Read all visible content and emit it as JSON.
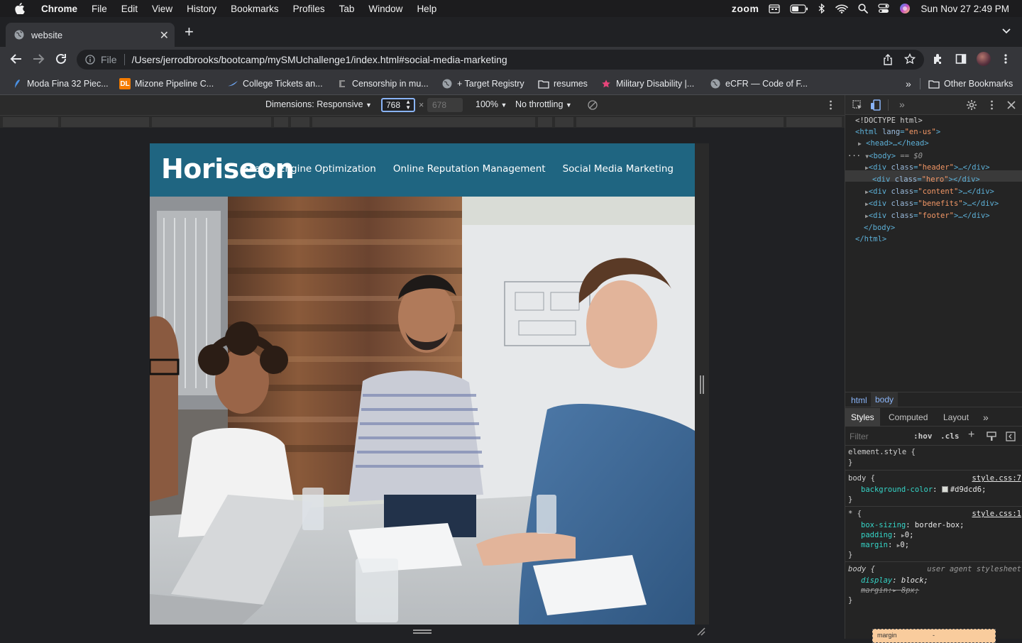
{
  "menubar": {
    "app": "Chrome",
    "items": [
      "File",
      "Edit",
      "View",
      "History",
      "Bookmarks",
      "Profiles",
      "Tab",
      "Window",
      "Help"
    ],
    "zoom": "zoom",
    "datetime": "Sun Nov 27  2:49 PM"
  },
  "tab": {
    "title": "website"
  },
  "toolbar": {
    "file_label": "File",
    "url": "/Users/jerrodbrooks/bootcamp/mySMUchallenge1/index.html#social-media-marketing"
  },
  "bookmarks": {
    "items": [
      {
        "label": "Moda Fina 32 Piec...",
        "icon": "bird-icon"
      },
      {
        "label": "Mizone Pipeline C...",
        "icon": "dl-icon",
        "badge": "DL"
      },
      {
        "label": "College Tickets an...",
        "icon": "swoosh-icon"
      },
      {
        "label": "Censorship in mu...",
        "icon": "site-icon"
      },
      {
        "label": "+ Target Registry",
        "icon": "globe-icon"
      },
      {
        "label": "resumes",
        "icon": "folder-icon"
      },
      {
        "label": "Military Disability |...",
        "icon": "star-icon"
      },
      {
        "label": "eCFR — Code of F...",
        "icon": "globe-icon"
      }
    ],
    "overflow": "»",
    "other": "Other Bookmarks"
  },
  "devbar": {
    "dimensions": "Dimensions: Responsive",
    "width": "768",
    "times": "×",
    "height": "678",
    "zoom": "100%",
    "throttle": "No throttling"
  },
  "page": {
    "logo": "Horiseon",
    "nav": [
      "Search Engine Optimization",
      "Online Reputation Management",
      "Social Media Marketing"
    ]
  },
  "devtools": {
    "dom": {
      "doctype": "<!DOCTYPE html>",
      "html_open": "<html",
      "lang_attr": "lang",
      "lang_val": "\"en-us\"",
      "head": "<head>…</head>",
      "body_open": "<body>",
      "body_eq": " == $0",
      "divs": [
        {
          "cls": "\"header\"",
          "rest": ">…</div>",
          "collapsed": true
        },
        {
          "cls": "\"hero\"",
          "rest": "></div>",
          "collapsed": false
        },
        {
          "cls": "\"content\"",
          "rest": ">…</div>",
          "collapsed": true
        },
        {
          "cls": "\"benefits\"",
          "rest": ">…</div>",
          "collapsed": true
        },
        {
          "cls": "\"footer\"",
          "rest": ">…</div>",
          "collapsed": true
        }
      ],
      "div_tag": "<div",
      "class_attr": "class",
      "body_close": "</body>",
      "html_close": "</html>"
    },
    "breadcrumbs": [
      "html",
      "body"
    ],
    "tabs": [
      "Styles",
      "Computed",
      "Layout"
    ],
    "filter_placeholder": "Filter",
    "hov": ":hov",
    "cls": ".cls",
    "styles": {
      "element_style": "element.style {",
      "close": "}",
      "body_rule": "body {",
      "body_src": "style.css:7",
      "bg_prop": "background-color",
      "bg_val": "#d9dcd6;",
      "bg_color": "#d9dcd6",
      "star_rule": "* {",
      "star_src": "style.css:1",
      "box_prop": "box-sizing",
      "box_val": "border-box;",
      "pad_prop": "padding",
      "pad_val": "0;",
      "margin_prop": "margin",
      "margin_val": "0;",
      "ua_rule": "body {",
      "ua_src": "user agent stylesheet",
      "display_prop": "display",
      "display_val": "block;",
      "ua_margin_prop": "margin",
      "ua_margin_val": "8px;",
      "boxmodel_label": "margin",
      "boxmodel_dash": "-"
    }
  },
  "colors": {
    "header_bg": "#1f6581",
    "page_bg": "#d9dcd6",
    "accent": "#8ab4f8"
  }
}
